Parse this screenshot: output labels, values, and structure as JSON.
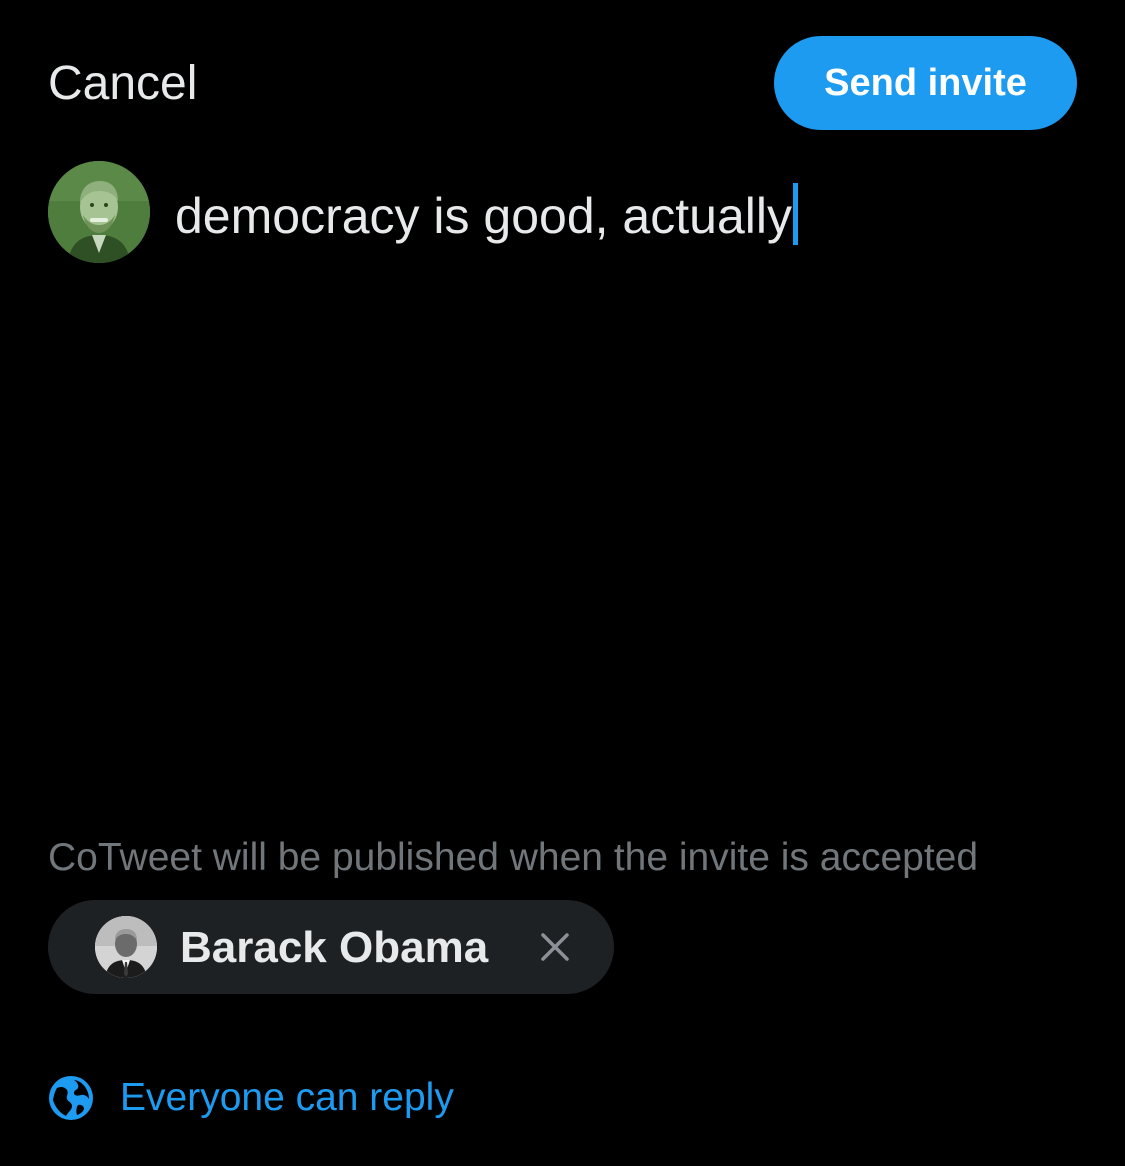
{
  "header": {
    "cancel_label": "Cancel",
    "send_label": "Send invite"
  },
  "composer": {
    "text": "democracy is good, actually"
  },
  "notice": {
    "text": "CoTweet will be published when the invite is accepted"
  },
  "invitee": {
    "name": "Barack Obama"
  },
  "reply_settings": {
    "label": "Everyone can reply"
  },
  "colors": {
    "accent": "#1d9bf0",
    "background": "#000000",
    "chip_background": "#1e2124",
    "muted_text": "#71767b"
  },
  "icons": {
    "close": "close-icon",
    "globe": "globe-icon"
  }
}
